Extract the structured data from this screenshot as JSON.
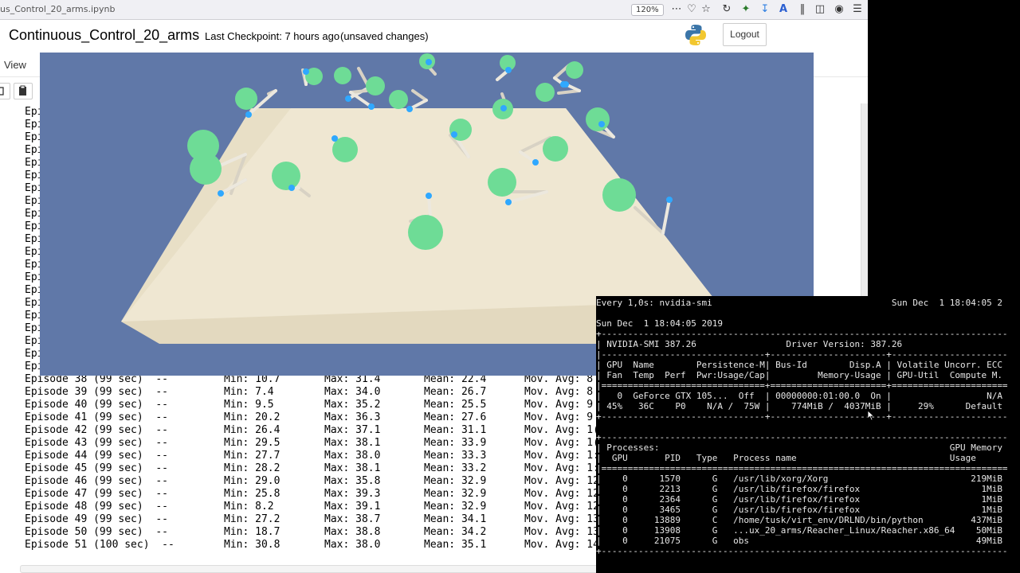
{
  "browser": {
    "url_fragment": "us_Control_20_arms.ipynb",
    "zoom": "120%",
    "toolbar_icons": [
      "more-icon",
      "pocket-icon",
      "star-icon",
      "reload-icon",
      "extension-icon",
      "download-icon",
      "reader-icon",
      "library-icon",
      "sidebar-icon",
      "account-icon",
      "menu-icon"
    ]
  },
  "notebook": {
    "title": "Continuous_Control_20_arms",
    "checkpoint": "Last Checkpoint: 7 hours ago",
    "status": "(unsaved changes)",
    "logout_label": "Logout",
    "menu_view": "View"
  },
  "log": {
    "hidden_prefix": "Epi",
    "rows": [
      {
        "episode": "Episode 38 (99 sec)  --",
        "min": "Min: 10.7",
        "max": "Max: 31.4",
        "mean": "Mean: 22.4",
        "mov": "Mov. Avg: 8"
      },
      {
        "episode": "Episode 39 (99 sec)  --",
        "min": "Min: 7.4",
        "max": "Max: 34.0",
        "mean": "Mean: 26.7",
        "mov": "Mov. Avg: 8"
      },
      {
        "episode": "Episode 40 (99 sec)  --",
        "min": "Min: 9.5",
        "max": "Max: 35.2",
        "mean": "Mean: 25.5",
        "mov": "Mov. Avg: 9"
      },
      {
        "episode": "Episode 41 (99 sec)  --",
        "min": "Min: 20.2",
        "max": "Max: 36.3",
        "mean": "Mean: 27.6",
        "mov": "Mov. Avg: 9"
      },
      {
        "episode": "Episode 42 (99 sec)  --",
        "min": "Min: 26.4",
        "max": "Max: 37.1",
        "mean": "Mean: 31.1",
        "mov": "Mov. Avg: 1("
      },
      {
        "episode": "Episode 43 (99 sec)  --",
        "min": "Min: 29.5",
        "max": "Max: 38.1",
        "mean": "Mean: 33.9",
        "mov": "Mov. Avg: 1("
      },
      {
        "episode": "Episode 44 (99 sec)  --",
        "min": "Min: 27.7",
        "max": "Max: 38.0",
        "mean": "Mean: 33.3",
        "mov": "Mov. Avg: 1:"
      },
      {
        "episode": "Episode 45 (99 sec)  --",
        "min": "Min: 28.2",
        "max": "Max: 38.1",
        "mean": "Mean: 33.2",
        "mov": "Mov. Avg: 1:"
      },
      {
        "episode": "Episode 46 (99 sec)  --",
        "min": "Min: 29.0",
        "max": "Max: 35.8",
        "mean": "Mean: 32.9",
        "mov": "Mov. Avg: 12"
      },
      {
        "episode": "Episode 47 (99 sec)  --",
        "min": "Min: 25.8",
        "max": "Max: 39.3",
        "mean": "Mean: 32.9",
        "mov": "Mov. Avg: 12"
      },
      {
        "episode": "Episode 48 (99 sec)  --",
        "min": "Min: 8.2",
        "max": "Max: 39.1",
        "mean": "Mean: 32.9",
        "mov": "Mov. Avg: 12"
      },
      {
        "episode": "Episode 49 (99 sec)  --",
        "min": "Min: 27.2",
        "max": "Max: 38.7",
        "mean": "Mean: 34.1",
        "mov": "Mov. Avg: 13"
      },
      {
        "episode": "Episode 50 (99 sec)  --",
        "min": "Min: 18.7",
        "max": "Max: 38.8",
        "mean": "Mean: 34.2",
        "mov": "Mov. Avg: 13"
      },
      {
        "episode": "Episode 51 (100 sec)  --",
        "min": "Min: 30.8",
        "max": "Max: 38.0",
        "mean": "Mean: 35.1",
        "mov": "Mov. Avg: 14"
      }
    ]
  },
  "terminal": {
    "lines": [
      "Every 1,0s: nvidia-smi                                  Sun Dec  1 18:04:05 2",
      "",
      "Sun Dec  1 18:04:05 2019",
      "+-----------------------------------------------------------------------------",
      "| NVIDIA-SMI 387.26                 Driver Version: 387.26",
      "|-------------------------------+----------------------+----------------------",
      "| GPU  Name        Persistence-M| Bus-Id        Disp.A | Volatile Uncorr. ECC",
      "| Fan  Temp  Perf  Pwr:Usage/Cap|         Memory-Usage | GPU-Util  Compute M.",
      "|===============================+======================+======================",
      "|   0  GeForce GTX 105...  Off  | 00000000:01:00.0  On |                  N/A",
      "| 45%   36C    P0    N/A /  75W |    774MiB /  4037MiB |     29%      Default",
      "+-------------------------------+----------------------+----------------------",
      "",
      "+-----------------------------------------------------------------------------",
      "| Processes:                                                       GPU Memory",
      "|  GPU       PID   Type   Process name                             Usage",
      "|=============================================================================",
      "|    0      1570      G   /usr/lib/xorg/Xorg                           219MiB",
      "|    0      2213      G   /usr/lib/firefox/firefox                       1MiB",
      "|    0      2364      G   /usr/lib/firefox/firefox                       1MiB",
      "|    0      3465      G   /usr/lib/firefox/firefox                       1MiB",
      "|    0     13889      C   /home/tusk/virt_env/DRLND/bin/python         437MiB",
      "|    0     13908      G   ...ux_20_arms/Reacher_Linux/Reacher.x86_64    50MiB",
      "|    0     21075      G   obs                                           49MiB",
      "+-----------------------------------------------------------------------------"
    ]
  },
  "colors": {
    "unity_sky": "#6078a8",
    "platform": "#ede5cf",
    "target_sphere": "#6edc96",
    "arm_tip": "#2fa8ff"
  }
}
